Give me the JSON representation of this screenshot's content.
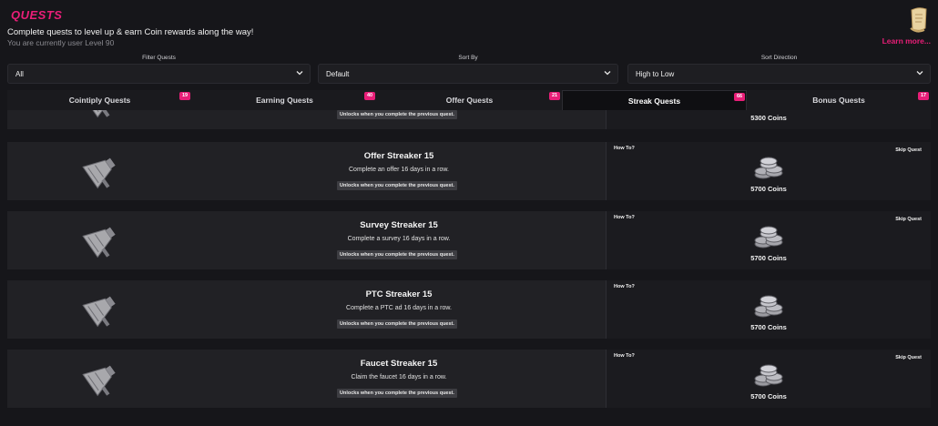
{
  "header": {
    "title": "QUESTS",
    "subtitle": "Complete quests to level up & earn Coin rewards along the way!",
    "level_text": "You are currently user Level 90",
    "learn_more": "Learn more..."
  },
  "filters": [
    {
      "label": "Filter Quests",
      "value": "All"
    },
    {
      "label": "Sort By",
      "value": "Default"
    },
    {
      "label": "Sort Direction",
      "value": "High to Low"
    }
  ],
  "tabs": [
    {
      "label": "Cointiply Quests",
      "badge": "19",
      "active": false
    },
    {
      "label": "Earning Quests",
      "badge": "40",
      "active": false
    },
    {
      "label": "Offer Quests",
      "badge": "21",
      "active": false
    },
    {
      "label": "Streak Quests",
      "badge": "66",
      "active": true
    },
    {
      "label": "Bonus Quests",
      "badge": "17",
      "active": false
    }
  ],
  "partial_card": {
    "lock_text": "Unlocks when you complete the previous quest.",
    "reward": "5300 Coins"
  },
  "quests": [
    {
      "title": "Offer Streaker 15",
      "description": "Complete an offer 16 days in a row.",
      "lock_text": "Unlocks when you complete the previous quest.",
      "how_to": "How To?",
      "skip": "Skip Quest",
      "reward": "5700 Coins"
    },
    {
      "title": "Survey Streaker 15",
      "description": "Complete a survey 16 days in a row.",
      "lock_text": "Unlocks when you complete the previous quest.",
      "how_to": "How To?",
      "skip": "Skip Quest",
      "reward": "5700 Coins"
    },
    {
      "title": "PTC Streaker 15",
      "description": "Complete a PTC ad 16 days in a row.",
      "lock_text": "Unlocks when you complete the previous quest.",
      "how_to": "How To?",
      "skip": "",
      "reward": "5700 Coins"
    },
    {
      "title": "Faucet Streaker 15",
      "description": "Claim the faucet 16 days in a row.",
      "lock_text": "Unlocks when you complete the previous quest.",
      "how_to": "How To?",
      "skip": "Skip Quest",
      "reward": "5700 Coins"
    }
  ],
  "colors": {
    "accent": "#e91e78",
    "background": "#16161a",
    "card": "#212125"
  },
  "icons": {
    "scroll": "scroll-icon",
    "quest": "megaphone-icon",
    "reward": "coin-stack-icon",
    "dropdown": "chevron-down-icon"
  }
}
